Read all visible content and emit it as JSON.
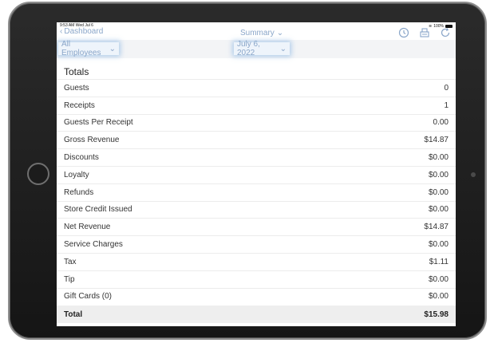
{
  "status_bar": {
    "time": "9:53 AM",
    "date": "Wed Jul 6",
    "battery": "100%"
  },
  "nav": {
    "back_label": "Dashboard",
    "title": "Summary"
  },
  "filters": {
    "employee": "All Employees",
    "date": "July 6, 2022"
  },
  "section_title": "Totals",
  "rows": [
    {
      "label": "Guests",
      "value": "0"
    },
    {
      "label": "Receipts",
      "value": "1"
    },
    {
      "label": "Guests Per Receipt",
      "value": "0.00"
    },
    {
      "label": "Gross Revenue",
      "value": "$14.87"
    },
    {
      "label": "Discounts",
      "value": "$0.00"
    },
    {
      "label": "Loyalty",
      "value": "$0.00"
    },
    {
      "label": "Refunds",
      "value": "$0.00"
    },
    {
      "label": "Store Credit Issued",
      "value": "$0.00"
    },
    {
      "label": "Net Revenue",
      "value": "$14.87"
    },
    {
      "label": "Service Charges",
      "value": "$0.00"
    },
    {
      "label": "Tax",
      "value": "$1.11"
    },
    {
      "label": "Tip",
      "value": "$0.00"
    },
    {
      "label": "Gift Cards (0)",
      "value": "$0.00"
    }
  ],
  "total": {
    "label": "Total",
    "value": "$15.98"
  },
  "icons": {
    "history": "clock-icon",
    "register": "cash-register-icon",
    "refresh": "refresh-icon"
  },
  "colors": {
    "accent": "#8aa6c9",
    "filter_bg": "#f3f4f6",
    "total_bg": "#eeeeee"
  }
}
